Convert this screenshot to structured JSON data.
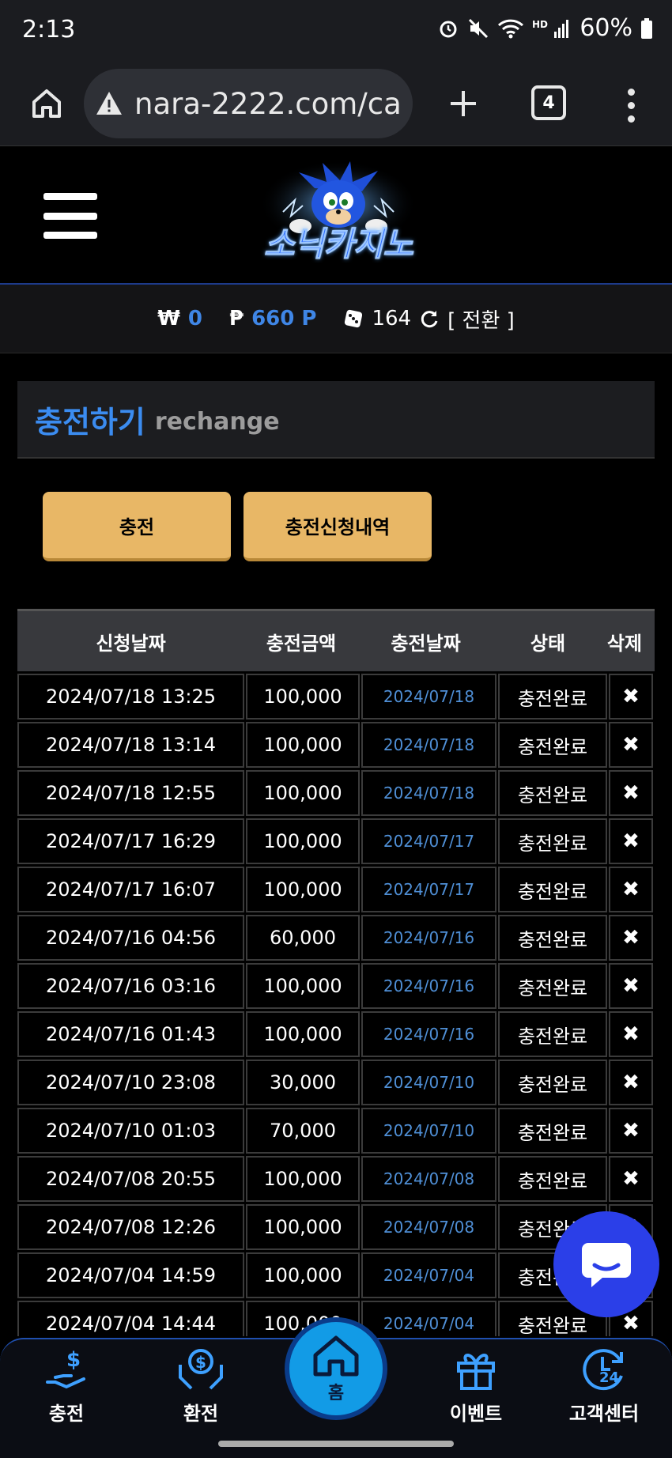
{
  "status_bar": {
    "time": "2:13",
    "battery": "60%"
  },
  "browser": {
    "url": "nara-2222.com/ca",
    "tab_count": "4"
  },
  "site": {
    "logo_text": "소닉카지노"
  },
  "balance": {
    "won_symbol": "₩",
    "won_value": "0",
    "point_symbol": "₱",
    "point_value": "660 P",
    "chip_value": "164",
    "switch_label": "[ 전환 ]"
  },
  "page": {
    "title_ko": "충전하기",
    "title_en": "rechange"
  },
  "buttons": {
    "charge": "충전",
    "history": "충전신청내역"
  },
  "table": {
    "headers": [
      "신청날짜",
      "충전금액",
      "충전날짜",
      "상태",
      "삭제"
    ],
    "rows": [
      {
        "requested": "2024/07/18 13:25",
        "amount": "100,000",
        "charged": "2024/07/18",
        "status": "충전완료"
      },
      {
        "requested": "2024/07/18 13:14",
        "amount": "100,000",
        "charged": "2024/07/18",
        "status": "충전완료"
      },
      {
        "requested": "2024/07/18 12:55",
        "amount": "100,000",
        "charged": "2024/07/18",
        "status": "충전완료"
      },
      {
        "requested": "2024/07/17 16:29",
        "amount": "100,000",
        "charged": "2024/07/17",
        "status": "충전완료"
      },
      {
        "requested": "2024/07/17 16:07",
        "amount": "100,000",
        "charged": "2024/07/17",
        "status": "충전완료"
      },
      {
        "requested": "2024/07/16 04:56",
        "amount": "60,000",
        "charged": "2024/07/16",
        "status": "충전완료"
      },
      {
        "requested": "2024/07/16 03:16",
        "amount": "100,000",
        "charged": "2024/07/16",
        "status": "충전완료"
      },
      {
        "requested": "2024/07/16 01:43",
        "amount": "100,000",
        "charged": "2024/07/16",
        "status": "충전완료"
      },
      {
        "requested": "2024/07/10 23:08",
        "amount": "30,000",
        "charged": "2024/07/10",
        "status": "충전완료"
      },
      {
        "requested": "2024/07/10 01:03",
        "amount": "70,000",
        "charged": "2024/07/10",
        "status": "충전완료"
      },
      {
        "requested": "2024/07/08 20:55",
        "amount": "100,000",
        "charged": "2024/07/08",
        "status": "충전완료"
      },
      {
        "requested": "2024/07/08 12:26",
        "amount": "100,000",
        "charged": "2024/07/08",
        "status": "충전완료"
      },
      {
        "requested": "2024/07/04 14:59",
        "amount": "100,000",
        "charged": "2024/07/04",
        "status": "충전완료"
      },
      {
        "requested": "2024/07/04 14:44",
        "amount": "100,000",
        "charged": "2024/07/04",
        "status": "충전완료"
      }
    ],
    "delete_glyph": "✖"
  },
  "bottom_nav": {
    "charge": "충전",
    "exchange": "환전",
    "home": "홈",
    "event": "이벤트",
    "support": "고객센터"
  },
  "icons": [
    "home-icon",
    "warning-icon",
    "plus-icon",
    "tabs-icon",
    "more-icon",
    "hamburger-icon",
    "refresh-icon",
    "dice-icon",
    "chat-icon",
    "delete-icon"
  ],
  "colors": {
    "accent_blue": "#3b8cf0",
    "button_gold": "#e8b766",
    "home_blue": "#129be6"
  }
}
